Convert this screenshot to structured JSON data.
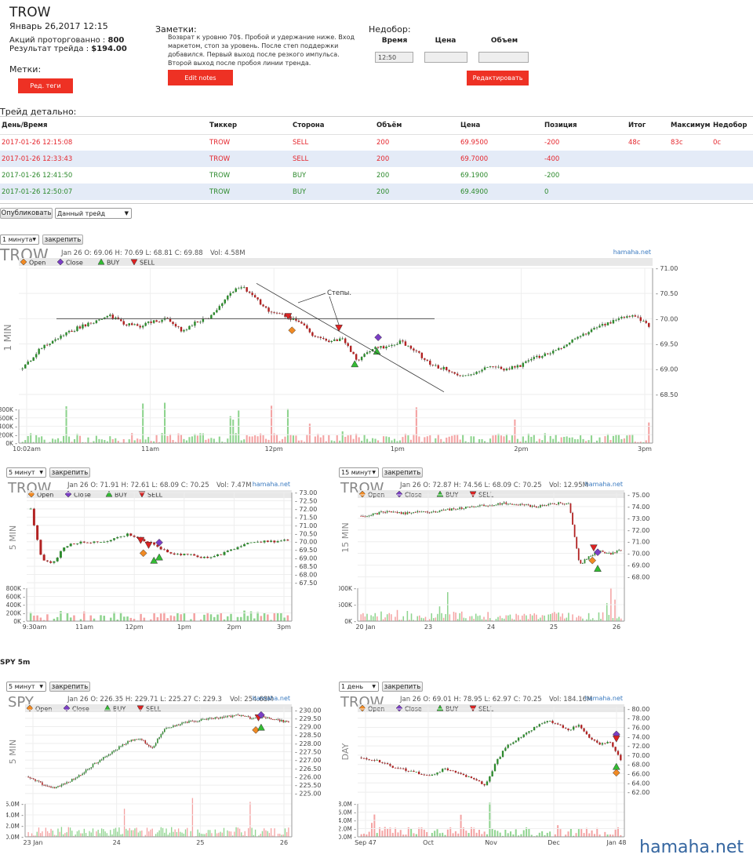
{
  "header": {
    "ticker": "TROW",
    "date": "Январь 26,2017 12:15",
    "shares_label": "Акций проторгованно :",
    "shares_value": "800",
    "result_label": "Результат трейда :",
    "result_value": "$194.00",
    "tags_label": "Метки:",
    "tags_button": "Ред. теги"
  },
  "notes": {
    "label": "Заметки:",
    "text": "Возврат к уровню 70$. Пробой и удержание ниже. Вход маркетом, стоп за уровень. После степ поддержки добавился. Первый выход после резкого импульса. Второй выход после пробоя линии тренда.",
    "edit_button": "Edit notes"
  },
  "shortfall": {
    "label": "Недобор:",
    "col_time": "Время",
    "col_price": "Цена",
    "col_volume": "Объем",
    "time_value": "12:50",
    "price_value": "",
    "volume_value": "",
    "edit_button": "Редактировать"
  },
  "trade_detail": {
    "label": "Трейд детально:",
    "columns": [
      "День/Время",
      "Тиккер",
      "Сторона",
      "Объём",
      "Цена",
      "Позиция",
      "Итог",
      "Максимум",
      "Недобор"
    ],
    "rows": [
      {
        "datetime": "2017-01-26 12:15:08",
        "ticker": "TROW",
        "side": "SELL",
        "volume": "200",
        "price": "69.9500",
        "position": "-200",
        "result": "48c",
        "max": "83c",
        "short": "0c",
        "kind": "sell"
      },
      {
        "datetime": "2017-01-26 12:33:43",
        "ticker": "TROW",
        "side": "SELL",
        "volume": "200",
        "price": "69.7000",
        "position": "-400",
        "result": "",
        "max": "",
        "short": "",
        "kind": "sell"
      },
      {
        "datetime": "2017-01-26 12:41:50",
        "ticker": "TROW",
        "side": "BUY",
        "volume": "200",
        "price": "69.1900",
        "position": "-200",
        "result": "",
        "max": "",
        "short": "",
        "kind": "buy"
      },
      {
        "datetime": "2017-01-26 12:50:07",
        "ticker": "TROW",
        "side": "BUY",
        "volume": "200",
        "price": "69.4900",
        "position": "0",
        "result": "",
        "max": "",
        "short": "",
        "kind": "buy"
      }
    ]
  },
  "publish": {
    "button": "Опубликовать",
    "select_value": "Данный трейд"
  },
  "pin_label": "закрепить",
  "spy_section_label": "SPY 5m",
  "watermark": "hamaha.net",
  "colors": {
    "accent_red": "#ee3124",
    "sell": "#e5272e",
    "buy": "#2d8a2d",
    "up_candle": "#2e8b2e",
    "down_candle": "#b22222",
    "volume_up": "#8fd48f",
    "volume_down": "#f4a3a3"
  },
  "chart_data": [
    {
      "id": "main",
      "type": "candlestick",
      "interval_select": "1 минута",
      "ticker": "TROW",
      "ohlc_line": "Jan 26 O: 69.06 H: 70.69 L: 68.81 C: 69.88",
      "vol_line": "Vol: 4.58M",
      "brand": "hamaha.net",
      "vertical_label": "1 MIN",
      "legend": [
        "Open",
        "Close",
        "BUY",
        "SELL"
      ],
      "ylim": [
        68.25,
        71.0
      ],
      "y_ticks": [
        "71.00",
        "70.50",
        "70.00",
        "69.50",
        "69.00",
        "68.50"
      ],
      "x_ticks": [
        "10:02am",
        "11am",
        "12pm",
        "1pm",
        "2pm",
        "3pm"
      ],
      "vol_ticks": [
        "800K",
        "600K",
        "400K",
        "200K",
        "0K"
      ],
      "annotation": "Степы.",
      "path": [
        69.0,
        69.35,
        69.55,
        69.7,
        69.85,
        69.95,
        70.05,
        69.9,
        69.85,
        69.95,
        70.0,
        69.75,
        69.95,
        70.05,
        70.45,
        70.65,
        70.4,
        70.1,
        70.05,
        69.95,
        69.65,
        69.55,
        69.6,
        69.15,
        69.4,
        69.45,
        69.55,
        69.35,
        69.1,
        69.0,
        68.85,
        68.9,
        69.05,
        69.0,
        69.05,
        69.2,
        69.3,
        69.45,
        69.6,
        69.75,
        69.9,
        70.0,
        70.05,
        69.85
      ],
      "x_range": [
        0,
        1
      ],
      "markers": [
        {
          "type": "sell",
          "x": 0.425,
          "y": 70.05
        },
        {
          "type": "open",
          "x": 0.431,
          "y": 69.77
        },
        {
          "type": "sell",
          "x": 0.505,
          "y": 69.82
        },
        {
          "type": "close",
          "x": 0.567,
          "y": 69.63
        },
        {
          "type": "buy",
          "x": 0.53,
          "y": 69.1
        },
        {
          "type": "buy",
          "x": 0.565,
          "y": 69.35
        }
      ]
    },
    {
      "id": "5min",
      "type": "candlestick",
      "interval_select": "5 минут",
      "ticker": "TROW",
      "ohlc_line": "Jan 26 O: 71.91 H: 72.61 L: 68.09 C: 70.25",
      "vol_line": "Vol: 7.47M",
      "brand": "hamaha.net",
      "vertical_label": "5 MIN",
      "legend": [
        "Open",
        "Close",
        "BUY",
        "SELL"
      ],
      "ylim": [
        67.5,
        73.0
      ],
      "y_ticks": [
        "73.00",
        "72.50",
        "72.00",
        "71.50",
        "71.00",
        "70.50",
        "70.00",
        "69.50",
        "69.00",
        "68.50",
        "68.00",
        "67.50"
      ],
      "x_ticks": [
        "9:30am",
        "11am",
        "12pm",
        "1pm",
        "2pm",
        "3pm"
      ],
      "vol_ticks": [
        "800K",
        "600K",
        "400K",
        "200K",
        "0K"
      ],
      "path": [
        72.0,
        69.0,
        68.6,
        69.6,
        69.9,
        70.0,
        69.95,
        70.0,
        70.2,
        70.45,
        70.2,
        70.0,
        69.6,
        69.35,
        69.2,
        69.3,
        69.0,
        69.1,
        69.3,
        69.6,
        69.9,
        70.0,
        70.05,
        70.0,
        70.1
      ],
      "markers": [
        {
          "type": "sell",
          "x": 0.43,
          "y": 70.1
        },
        {
          "type": "sell",
          "x": 0.46,
          "y": 69.8
        },
        {
          "type": "open",
          "x": 0.44,
          "y": 69.3
        },
        {
          "type": "close",
          "x": 0.5,
          "y": 69.95
        },
        {
          "type": "buy",
          "x": 0.48,
          "y": 68.85
        },
        {
          "type": "buy",
          "x": 0.5,
          "y": 69.05
        }
      ]
    },
    {
      "id": "15min",
      "type": "candlestick",
      "interval_select": "15 минут",
      "ticker": "TROW",
      "ohlc_line": "Jan 26 O: 72.87 H: 74.56 L: 68.09 C: 70.25",
      "vol_line": "Vol: 12.95M",
      "brand": "hamaha.net",
      "vertical_label": "15 MIN",
      "legend": [
        "Open",
        "Close",
        "BUY",
        "SELL"
      ],
      "ylim": [
        67.5,
        75.2
      ],
      "y_ticks": [
        "75.00",
        "74.00",
        "73.00",
        "72.00",
        "71.00",
        "70.00",
        "69.00",
        "68.00"
      ],
      "x_ticks": [
        "20 Jan",
        "23",
        "24",
        "25",
        "26"
      ],
      "vol_ticks": [
        "000K",
        "500K",
        "0K"
      ],
      "path": [
        73.2,
        73.3,
        73.5,
        73.6,
        73.4,
        73.5,
        73.6,
        73.5,
        73.7,
        73.8,
        73.9,
        74.0,
        74.1,
        74.2,
        74.3,
        74.2,
        74.1,
        74.0,
        74.2,
        74.3,
        74.2,
        69.0,
        69.8,
        70.2,
        70.0,
        70.3
      ],
      "markers": [
        {
          "type": "sell",
          "x": 0.885,
          "y": 70.5
        },
        {
          "type": "open",
          "x": 0.88,
          "y": 69.4
        },
        {
          "type": "close",
          "x": 0.9,
          "y": 70.1
        },
        {
          "type": "buy",
          "x": 0.9,
          "y": 68.7
        }
      ]
    },
    {
      "id": "spy5",
      "type": "candlestick",
      "interval_select": "5 минут",
      "ticker": "SPY",
      "ohlc_line": "Jan 26 O: 226.35 H: 229.71 L: 225.27 C: 229.3",
      "vol_line": "Vol: 254.68M",
      "brand": "hamaha.net",
      "vertical_label": "5 MIN",
      "legend": [
        "Open",
        "Close",
        "BUY",
        "SELL"
      ],
      "ylim": [
        224.8,
        230.2
      ],
      "y_ticks": [
        "230.00",
        "229.50",
        "229.00",
        "228.50",
        "228.00",
        "227.50",
        "227.00",
        "226.50",
        "226.00",
        "225.50",
        "225.00"
      ],
      "x_ticks": [
        "23 Jan",
        "24",
        "25",
        "26"
      ],
      "vol_ticks": [
        "6.0M",
        "4.0M",
        "2.0M",
        "0.0M"
      ],
      "path": [
        226.0,
        225.6,
        225.3,
        225.6,
        226.0,
        226.6,
        227.1,
        227.6,
        228.1,
        228.3,
        227.7,
        228.9,
        229.1,
        229.3,
        229.4,
        229.5,
        229.6,
        229.7,
        229.5,
        229.6,
        229.4,
        229.3
      ],
      "markers": [
        {
          "type": "sell",
          "x": 0.875,
          "y": 229.55
        },
        {
          "type": "close",
          "x": 0.885,
          "y": 229.7
        },
        {
          "type": "open",
          "x": 0.865,
          "y": 228.8
        },
        {
          "type": "buy",
          "x": 0.885,
          "y": 228.95
        }
      ]
    },
    {
      "id": "daily",
      "type": "candlestick",
      "interval_select": "1 день",
      "ticker": "TROW",
      "ohlc_line": "Jan 26 O: 69.01 H: 78.95 L: 62.97 C: 70.25",
      "vol_line": "Vol: 184.16M",
      "brand": "hamaha.net",
      "vertical_label": "DAY",
      "legend": [
        "Open",
        "Close",
        "BUY",
        "SELL"
      ],
      "ylim": [
        61.0,
        80.5
      ],
      "y_ticks": [
        "80.00",
        "78.00",
        "76.00",
        "74.00",
        "72.00",
        "70.00",
        "68.00",
        "66.00",
        "64.00",
        "62.00"
      ],
      "x_ticks": [
        "Sep 47",
        "Oct",
        "Nov",
        "Dec",
        "Jan 48"
      ],
      "vol_ticks": [
        "8.0M",
        "6.0M",
        "4.0M",
        "2.0M",
        "0.0M"
      ],
      "path": [
        69.5,
        69.0,
        68.5,
        67.5,
        67.0,
        66.5,
        65.5,
        66.0,
        67.0,
        66.5,
        65.5,
        64.5,
        63.5,
        68.5,
        72.0,
        73.5,
        75.0,
        76.5,
        77.5,
        76.5,
        75.5,
        76.5,
        73.5,
        72.5,
        73.0,
        69.0
      ],
      "markers": [
        {
          "type": "close",
          "x": 0.97,
          "y": 74.5
        },
        {
          "type": "sell",
          "x": 0.97,
          "y": 73.6
        },
        {
          "type": "buy",
          "x": 0.97,
          "y": 67.5
        },
        {
          "type": "open",
          "x": 0.97,
          "y": 66.2
        }
      ]
    }
  ]
}
